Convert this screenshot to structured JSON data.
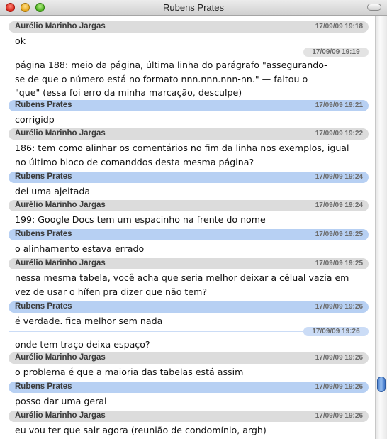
{
  "window": {
    "title": "Rubens Prates"
  },
  "messages": [
    {
      "kind": "header",
      "color": "gray",
      "name": "Aurélio Marinho Jargas",
      "time": "17/09/09 19:18",
      "text": "ok"
    },
    {
      "kind": "cont",
      "color": "gray",
      "time": "17/09/09 19:19",
      "text": "página 188: meio da página, última linha do parágrafo \"assegurando-",
      "text2": "se de que o número está no formato nnn.nnn.nnn-nn.\" — faltou o",
      "text3": "\"que\" (essa foi erro da minha marcação, desculpe)"
    },
    {
      "kind": "header",
      "color": "blue",
      "name": "Rubens Prates",
      "time": "17/09/09 19:21",
      "text": "corrigidp"
    },
    {
      "kind": "header",
      "color": "gray",
      "name": "Aurélio Marinho Jargas",
      "time": "17/09/09 19:22",
      "text": "186: tem como alinhar os comentários no fim da linha nos exemplos, igual",
      "text2": "no último bloco de comanddos desta mesma página?"
    },
    {
      "kind": "header",
      "color": "blue",
      "name": "Rubens Prates",
      "time": "17/09/09 19:24",
      "text": "dei uma ajeitada"
    },
    {
      "kind": "header",
      "color": "gray",
      "name": "Aurélio Marinho Jargas",
      "time": "17/09/09 19:24",
      "text": "199: Google Docs tem um espacinho na frente do nome"
    },
    {
      "kind": "header",
      "color": "blue",
      "name": "Rubens Prates",
      "time": "17/09/09 19:25",
      "text": "o alinhamento estava errado"
    },
    {
      "kind": "header",
      "color": "gray",
      "name": "Aurélio Marinho Jargas",
      "time": "17/09/09 19:25",
      "text": "nessa mesma tabela, você acha que seria melhor  deixar a célual vazia em",
      "text2": "vez de usar o hífen pra dizer que não tem?"
    },
    {
      "kind": "header",
      "color": "blue",
      "name": "Rubens Prates",
      "time": "17/09/09 19:26",
      "text": "é verdade. fica melhor sem nada"
    },
    {
      "kind": "cont",
      "color": "blue",
      "time": "17/09/09 19:26",
      "text": "onde tem traço deixa espaço?"
    },
    {
      "kind": "header",
      "color": "gray",
      "name": "Aurélio Marinho Jargas",
      "time": "17/09/09 19:26",
      "text": "o problema é que a maioria das tabelas está assim"
    },
    {
      "kind": "header",
      "color": "blue",
      "name": "Rubens Prates",
      "time": "17/09/09 19:26",
      "text": "posso dar uma geral"
    },
    {
      "kind": "header",
      "color": "gray",
      "name": "Aurélio Marinho Jargas",
      "time": "17/09/09 19:26",
      "text": "eu vou ter que sair agora (reunião de condomínio, argh)"
    }
  ]
}
